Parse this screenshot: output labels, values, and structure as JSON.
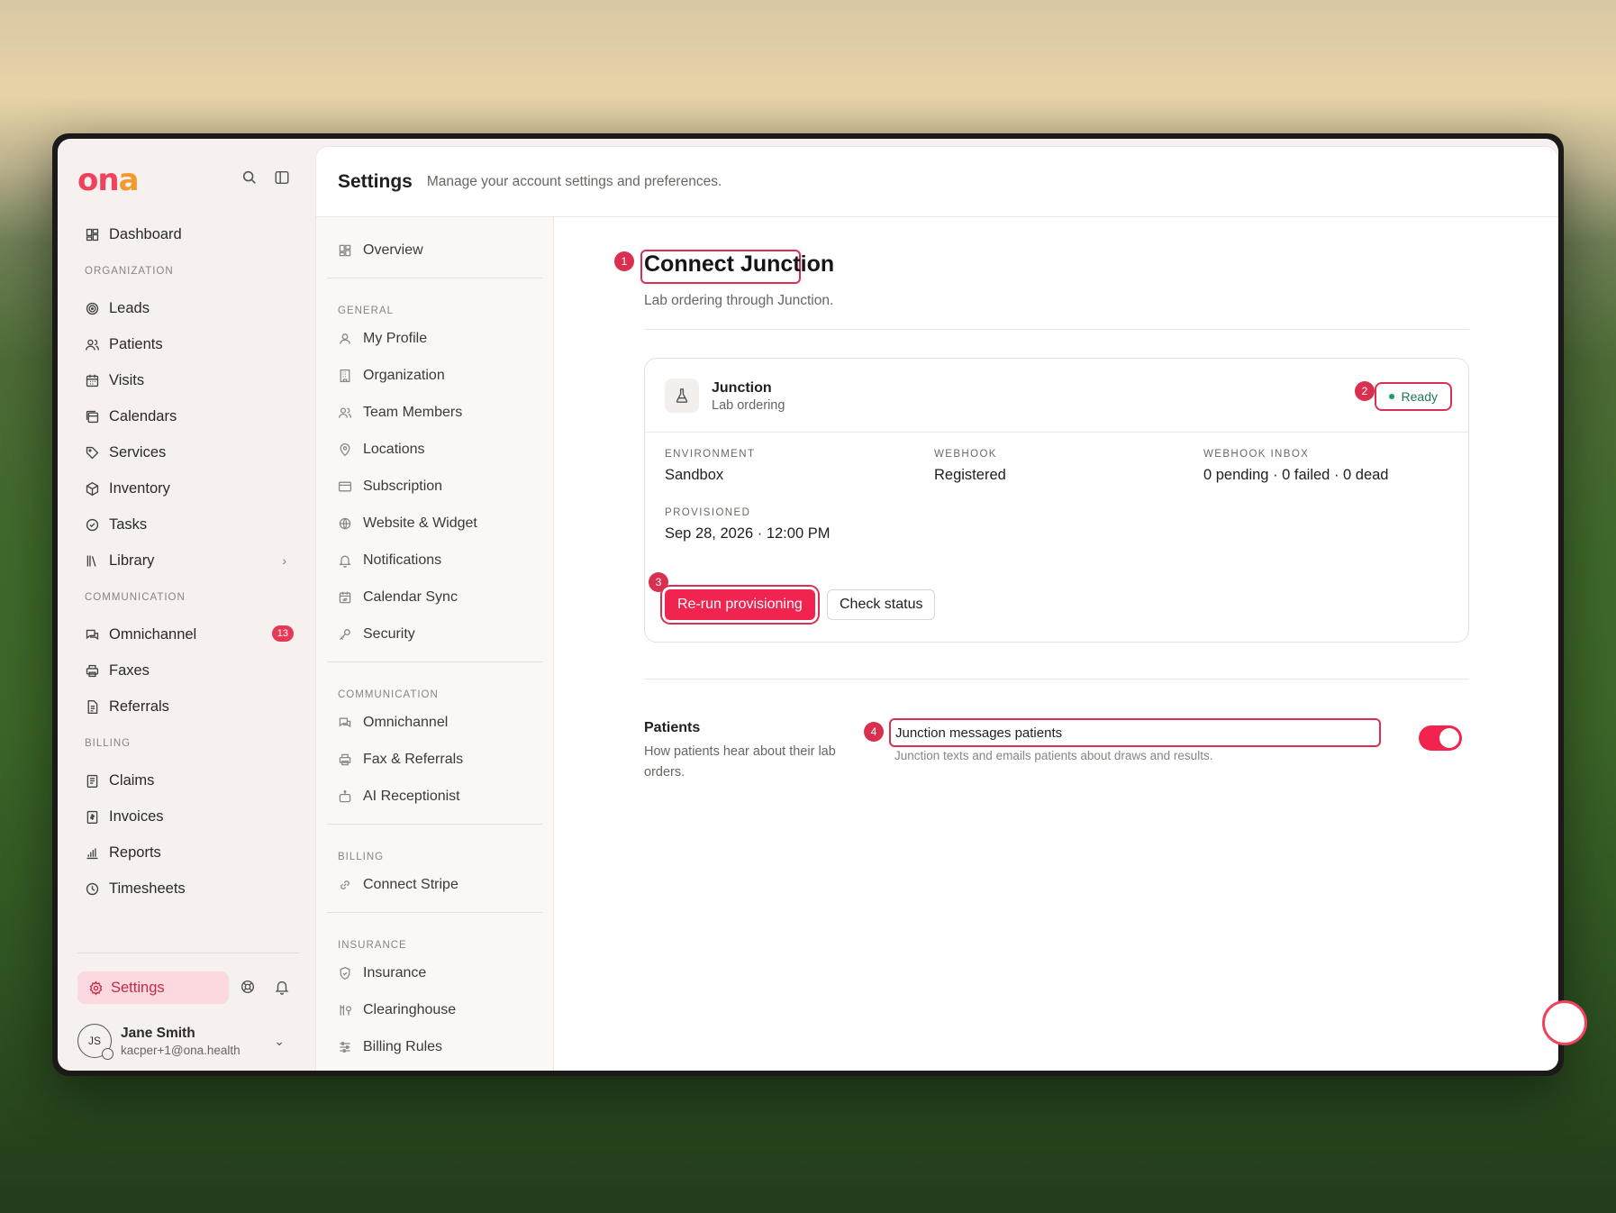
{
  "app": {
    "logo_main": "on",
    "logo_accent": "a"
  },
  "sidebar": {
    "dashboard": "Dashboard",
    "sections": {
      "organization": "ORGANIZATION",
      "communication": "COMMUNICATION",
      "billing": "BILLING"
    },
    "organization_items": [
      "Leads",
      "Patients",
      "Visits",
      "Calendars",
      "Services",
      "Inventory",
      "Tasks",
      "Library"
    ],
    "communication_items": [
      "Omnichannel",
      "Faxes",
      "Referrals"
    ],
    "omnichannel_badge": "13",
    "billing_items": [
      "Claims",
      "Invoices",
      "Reports",
      "Timesheets"
    ],
    "settings_label": "Settings",
    "user": {
      "initials": "JS",
      "name": "Jane Smith",
      "email": "kacper+1@ona.health"
    }
  },
  "header": {
    "title": "Settings",
    "subtitle": "Manage your account settings and preferences."
  },
  "subnav": {
    "overview": "Overview",
    "general_label": "GENERAL",
    "general": [
      "My Profile",
      "Organization",
      "Team Members",
      "Locations",
      "Subscription",
      "Website & Widget",
      "Notifications",
      "Calendar Sync",
      "Security"
    ],
    "communication_label": "COMMUNICATION",
    "communication": [
      "Omnichannel",
      "Fax & Referrals",
      "AI Receptionist"
    ],
    "billing_label": "BILLING",
    "billing": [
      "Connect Stripe"
    ],
    "insurance_label": "INSURANCE",
    "insurance": [
      "Insurance",
      "Clearinghouse",
      "Billing Rules"
    ]
  },
  "page": {
    "title": "Connect Junction",
    "subtitle": "Lab ordering through Junction.",
    "annotations": [
      "1",
      "2",
      "3",
      "4"
    ],
    "card": {
      "name": "Junction",
      "sub": "Lab ordering",
      "status": "Ready",
      "fields": {
        "environment_label": "ENVIRONMENT",
        "environment": "Sandbox",
        "webhook_label": "WEBHOOK",
        "webhook": "Registered",
        "inbox_label": "WEBHOOK INBOX",
        "inbox": "0 pending · 0 failed · 0 dead",
        "provisioned_label": "PROVISIONED",
        "provisioned": "Sep 28, 2026 · 12:00 PM"
      },
      "rerun_button": "Re-run provisioning",
      "check_button": "Check status"
    },
    "patients": {
      "title": "Patients",
      "desc": "How patients hear about their lab orders.",
      "toggle_label": "Junction messages patients",
      "toggle_desc": "Junction texts and emails patients about draws and results.",
      "toggle_on": true
    }
  },
  "colors": {
    "accent": "#f0244f",
    "annotation": "#d9304f",
    "ready": "#1f9d66"
  }
}
